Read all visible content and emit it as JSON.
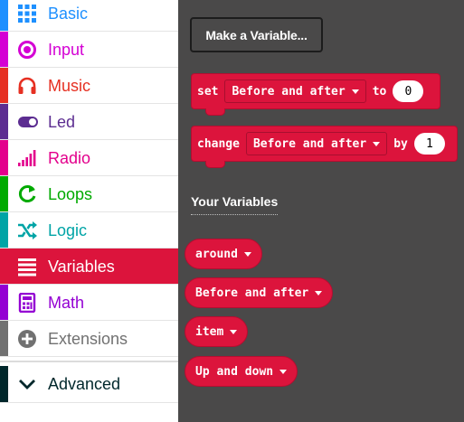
{
  "toolbox": {
    "categories": [
      {
        "label": "Basic",
        "color": "#1e90ff",
        "icon": "grid-icon"
      },
      {
        "label": "Input",
        "color": "#d400d4",
        "icon": "radio-button-icon"
      },
      {
        "label": "Music",
        "color": "#e63022",
        "icon": "headphones-icon"
      },
      {
        "label": "Led",
        "color": "#5c2d91",
        "icon": "toggle-icon"
      },
      {
        "label": "Radio",
        "color": "#e3008c",
        "icon": "signal-bars-icon"
      },
      {
        "label": "Loops",
        "color": "#00aa00",
        "icon": "loop-arrow-icon"
      },
      {
        "label": "Logic",
        "color": "#00a4a6",
        "icon": "shuffle-icon"
      },
      {
        "label": "Variables",
        "color": "#dc143c",
        "icon": "list-icon",
        "selected": true
      },
      {
        "label": "Math",
        "color": "#9400d3",
        "icon": "calculator-icon"
      },
      {
        "label": "Extensions",
        "color": "#717171",
        "icon": "plus-circle-icon"
      }
    ],
    "advanced": {
      "label": "Advanced",
      "color": "#00272b",
      "icon": "chevron-down-icon"
    }
  },
  "flyout": {
    "make_variable_label": "Make a Variable...",
    "set_block": {
      "keyword": "set",
      "variable": "Before and after",
      "to_keyword": "to",
      "value": "0"
    },
    "change_block": {
      "keyword": "change",
      "variable": "Before and after",
      "by_keyword": "by",
      "value": "1"
    },
    "your_variables_heading": "Your Variables",
    "variables": [
      "around",
      "Before and after",
      "item",
      "Up and down"
    ]
  }
}
